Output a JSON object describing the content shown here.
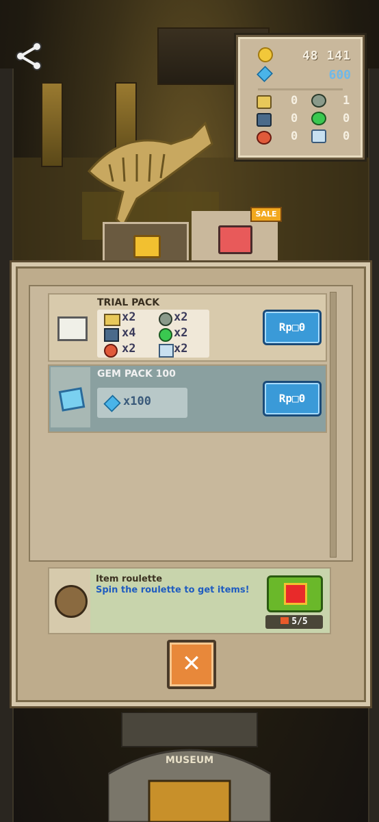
{
  "stats": {
    "coins": "48 141",
    "gems": "600",
    "inventory": [
      {
        "icon": "ticket-icon",
        "value": "0"
      },
      {
        "icon": "magnifier-icon",
        "value": "1"
      },
      {
        "icon": "trash-bin-icon",
        "value": "0"
      },
      {
        "icon": "potion-icon",
        "value": "0"
      },
      {
        "icon": "stop-icon",
        "value": "0"
      },
      {
        "icon": "robot-icon",
        "value": "0"
      }
    ]
  },
  "tabs": {
    "sale_badge": "SALE"
  },
  "shop": {
    "packs": [
      {
        "title": "TRIAL PACK",
        "items": [
          "x2",
          "x2",
          "x4",
          "x2",
          "x2",
          "x2"
        ],
        "price": "Rp□0"
      },
      {
        "title": "GEM PACK 100",
        "items": [
          "x100"
        ],
        "price": "Rp□0"
      }
    ],
    "roulette": {
      "title": "Item roulette",
      "description": "Spin the roulette to get items!",
      "counter": "5/5"
    },
    "close_symbol": "✕"
  },
  "building": {
    "sign": "MUSEUM"
  },
  "colors": {
    "accent_blue": "#3a9ad8",
    "spin_green": "#6ab82a",
    "close_orange": "#e8883a"
  }
}
